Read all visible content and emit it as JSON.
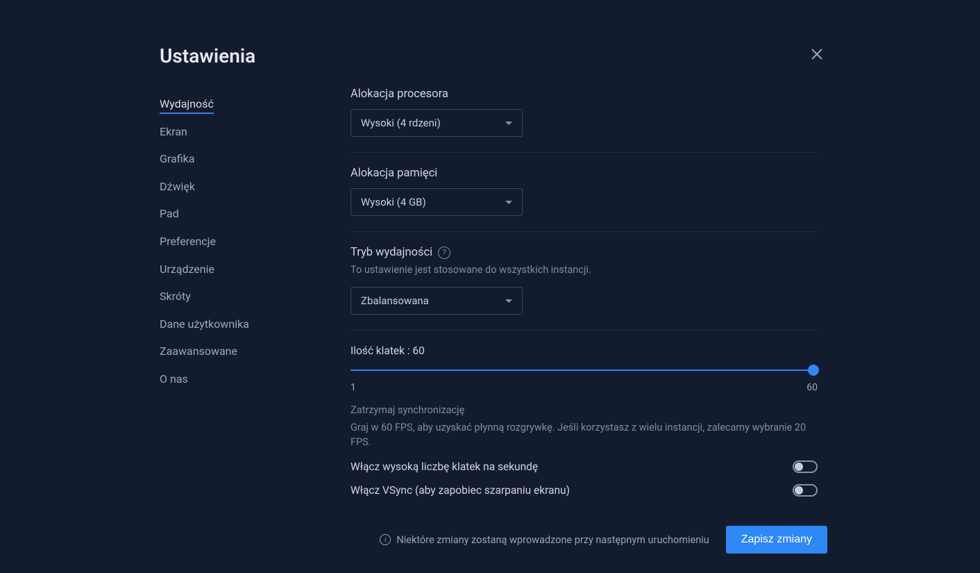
{
  "header": {
    "title": "Ustawienia"
  },
  "sidebar": {
    "items": [
      {
        "label": "Wydajność",
        "active": true
      },
      {
        "label": "Ekran",
        "active": false
      },
      {
        "label": "Grafika",
        "active": false
      },
      {
        "label": "Dźwięk",
        "active": false
      },
      {
        "label": "Pad",
        "active": false
      },
      {
        "label": "Preferencje",
        "active": false
      },
      {
        "label": "Urządzenie",
        "active": false
      },
      {
        "label": "Skróty",
        "active": false
      },
      {
        "label": "Dane użytkownika",
        "active": false
      },
      {
        "label": "Zaawansowane",
        "active": false
      },
      {
        "label": "O nas",
        "active": false
      }
    ]
  },
  "settings": {
    "cpu": {
      "title": "Alokacja procesora",
      "value": "Wysoki (4 rdzeni)"
    },
    "ram": {
      "title": "Alokacja pamięci",
      "value": "Wysoki (4 GB)"
    },
    "perfmode": {
      "title": "Tryb wydajności",
      "desc": "To ustawienie jest stosowane do wszystkich instancji.",
      "value": "Zbalansowana"
    },
    "fps": {
      "label": "Ilość klatek : 60",
      "min": "1",
      "max": "60",
      "sub_caption": "Zatrzymaj synchronizację",
      "sub_desc": "Graj w 60 FPS, aby uzyskać płynną rozgrywkę. Jeśli korzystasz z wielu instancji, zalecamy wybranie 20 FPS.",
      "toggle_high_fps": "Włącz wysoką liczbę klatek na sekundę",
      "toggle_vsync": "Włącz VSync (aby zapobiec szarpaniu ekranu)"
    }
  },
  "footer": {
    "note": "Niektóre zmiany zostaną wprowadzone przy następnym uruchomieniu",
    "save": "Zapisz zmiany"
  }
}
